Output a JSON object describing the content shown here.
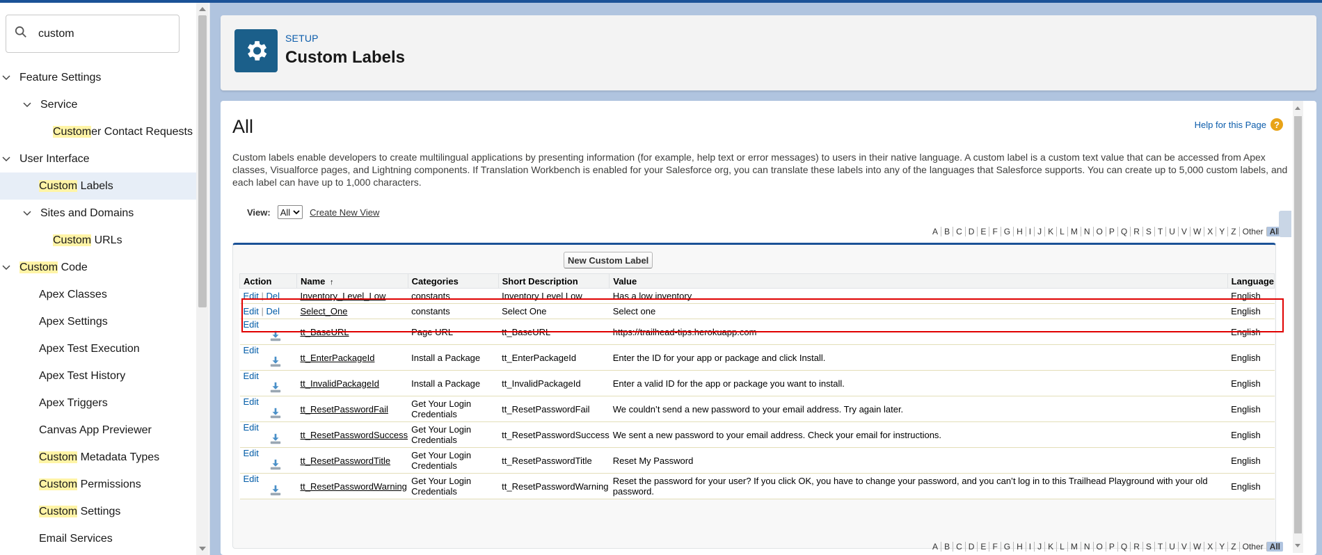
{
  "search": {
    "value": "custom"
  },
  "sidebar": {
    "items": [
      {
        "pre": "",
        "hl": "",
        "post": "Feature Settings"
      },
      {
        "pre": "",
        "hl": "",
        "post": "Service"
      },
      {
        "pre": "",
        "hl": "Custom",
        "post": "er Contact Requests"
      },
      {
        "pre": "",
        "hl": "",
        "post": "User Interface"
      },
      {
        "pre": "",
        "hl": "Custom",
        "post": " Labels"
      },
      {
        "pre": "",
        "hl": "",
        "post": "Sites and Domains"
      },
      {
        "pre": "",
        "hl": "Custom",
        "post": " URLs"
      },
      {
        "pre": "",
        "hl": "Custom",
        "post": " Code"
      },
      {
        "pre": "",
        "hl": "",
        "post": "Apex Classes"
      },
      {
        "pre": "",
        "hl": "",
        "post": "Apex Settings"
      },
      {
        "pre": "",
        "hl": "",
        "post": "Apex Test Execution"
      },
      {
        "pre": "",
        "hl": "",
        "post": "Apex Test History"
      },
      {
        "pre": "",
        "hl": "",
        "post": "Apex Triggers"
      },
      {
        "pre": "",
        "hl": "",
        "post": "Canvas App Previewer"
      },
      {
        "pre": "",
        "hl": "Custom",
        "post": " Metadata Types"
      },
      {
        "pre": "",
        "hl": "Custom",
        "post": " Permissions"
      },
      {
        "pre": "",
        "hl": "Custom",
        "post": " Settings"
      },
      {
        "pre": "",
        "hl": "",
        "post": "Email Services"
      }
    ]
  },
  "header": {
    "setup_label": "SETUP",
    "title": "Custom Labels"
  },
  "content": {
    "heading": "All",
    "help_link": "Help for this Page",
    "help_icon": "?",
    "description": "Custom labels enable developers to create multilingual applications by presenting information (for example, help text or error messages) to users in their native language. A custom label is a custom text value that can be accessed from Apex classes, Visualforce pages, and Lightning components. If Translation Workbench is enabled for your Salesforce org, you can translate these labels into any of the languages that Salesforce supports. You can create up to 5,000 custom labels, and each label can have up to 1,000 characters.",
    "view_label": "View:",
    "view_value": "All",
    "create_view": "Create New View",
    "new_button": "New Custom Label"
  },
  "alphabet": [
    "A",
    "B",
    "C",
    "D",
    "E",
    "F",
    "G",
    "H",
    "I",
    "J",
    "K",
    "L",
    "M",
    "N",
    "O",
    "P",
    "Q",
    "R",
    "S",
    "T",
    "U",
    "V",
    "W",
    "X",
    "Y",
    "Z",
    "Other",
    "All"
  ],
  "table": {
    "headers": {
      "action": "Action",
      "name": "Name",
      "sort_arrow": "↑",
      "categories": "Categories",
      "short": "Short Description",
      "value": "Value",
      "language": "Language"
    },
    "edit": "Edit",
    "del": "Del",
    "sep": "|",
    "rows": [
      {
        "name": "Inventory_Level_Low",
        "cat": "constants",
        "short": "Inventory Level Low",
        "value": "Has a low inventory",
        "lang": "English",
        "managed": false
      },
      {
        "name": "Select_One",
        "cat": "constants",
        "short": "Select One",
        "value": "Select one",
        "lang": "English",
        "managed": false
      },
      {
        "name": "tt_BaseURL",
        "cat": "Page URL",
        "short": "tt_BaseURL",
        "value": "https://trailhead-tips.herokuapp.com",
        "lang": "English",
        "managed": true
      },
      {
        "name": "tt_EnterPackageId",
        "cat": "Install a Package",
        "short": "tt_EnterPackageId",
        "value": "Enter the ID for your app or package and click Install.",
        "lang": "English",
        "managed": true
      },
      {
        "name": "tt_InvalidPackageId",
        "cat": "Install a Package",
        "short": "tt_InvalidPackageId",
        "value": "Enter a valid ID for the app or package you want to install.",
        "lang": "English",
        "managed": true
      },
      {
        "name": "tt_ResetPasswordFail",
        "cat": "Get Your Login Credentials",
        "short": "tt_ResetPasswordFail",
        "value": "We couldn’t send a new password to your email address. Try again later.",
        "lang": "English",
        "managed": true
      },
      {
        "name": "tt_ResetPasswordSuccess",
        "cat": "Get Your Login Credentials",
        "short": "tt_ResetPasswordSuccess",
        "value": "We sent a new password to your email address. Check your email for instructions.",
        "lang": "English",
        "managed": true
      },
      {
        "name": "tt_ResetPasswordTitle",
        "cat": "Get Your Login Credentials",
        "short": "tt_ResetPasswordTitle",
        "value": "Reset My Password",
        "lang": "English",
        "managed": true
      },
      {
        "name": "tt_ResetPasswordWarning",
        "cat": "Get Your Login Credentials",
        "short": "tt_ResetPasswordWarning",
        "value": "Reset the password for your user? If you click OK, you have to change your password, and you can’t log in to this Trailhead Playground with your old password.",
        "lang": "English",
        "managed": true
      }
    ]
  },
  "colors": {
    "accent": "#1b5297",
    "link": "#015ba7",
    "highlight": "#fff4a6",
    "outline": "#e00000"
  }
}
